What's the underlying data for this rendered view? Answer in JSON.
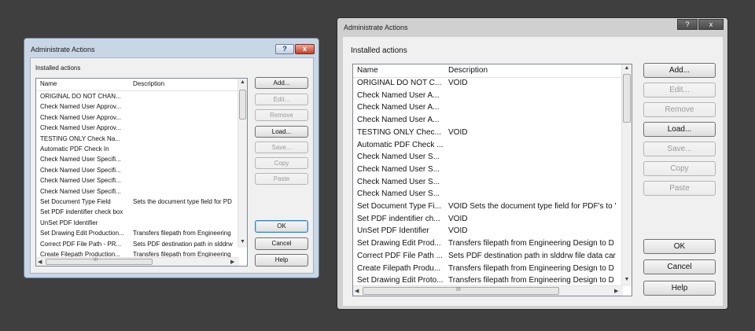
{
  "dialog_title": "Administrate Actions",
  "installed_label": "Installed actions",
  "columns": {
    "name": "Name",
    "description": "Description"
  },
  "title_buttons": {
    "help": "?",
    "close": "x"
  },
  "scroll_grip": "III",
  "buttons": {
    "add": "Add...",
    "edit": "Edit...",
    "remove": "Remove",
    "load": "Load...",
    "save": "Save...",
    "copy": "Copy",
    "paste": "Paste",
    "ok": "OK",
    "cancel": "Cancel",
    "help": "Help"
  },
  "small_rows": [
    {
      "name": "ORIGINAL DO NOT CHAN...",
      "desc": ""
    },
    {
      "name": "Check Named User Approv...",
      "desc": ""
    },
    {
      "name": "Check Named User Approv...",
      "desc": ""
    },
    {
      "name": "Check Named User Approv...",
      "desc": ""
    },
    {
      "name": "TESTING ONLY Check Na...",
      "desc": ""
    },
    {
      "name": "Automatic PDF Check In",
      "desc": ""
    },
    {
      "name": "Check Named User Specifi...",
      "desc": ""
    },
    {
      "name": "Check Named User Specifi...",
      "desc": ""
    },
    {
      "name": "Check Named User Specifi...",
      "desc": ""
    },
    {
      "name": "Check Named User Specifi...",
      "desc": ""
    },
    {
      "name": "Set Document Type Field",
      "desc": "Sets the document type field for PD"
    },
    {
      "name": "Set PDF indentifier check box",
      "desc": ""
    },
    {
      "name": "UnSet PDF Identifier",
      "desc": ""
    },
    {
      "name": "Set Drawing Edit Production...",
      "desc": "Transfers filepath from Engineering"
    },
    {
      "name": "Correct PDF File Path - PR...",
      "desc": "Sets PDF destination path in slddrw"
    },
    {
      "name": "Create Filepath Production...",
      "desc": "Transfers filepath from Engineering"
    }
  ],
  "large_rows": [
    {
      "name": "ORIGINAL DO NOT C...",
      "desc": "VOID"
    },
    {
      "name": "Check Named User A...",
      "desc": ""
    },
    {
      "name": "Check Named User A...",
      "desc": ""
    },
    {
      "name": "Check Named User A...",
      "desc": ""
    },
    {
      "name": "TESTING ONLY Chec...",
      "desc": "VOID"
    },
    {
      "name": "Automatic PDF Check ...",
      "desc": ""
    },
    {
      "name": "Check Named User S...",
      "desc": ""
    },
    {
      "name": "Check Named User S...",
      "desc": ""
    },
    {
      "name": "Check Named User S...",
      "desc": ""
    },
    {
      "name": "Check Named User S...",
      "desc": ""
    },
    {
      "name": "Set Document Type Fi...",
      "desc": "VOID Sets the document type field for PDF's to '"
    },
    {
      "name": "Set PDF indentifier ch...",
      "desc": "VOID"
    },
    {
      "name": "UnSet PDF Identifier",
      "desc": "VOID"
    },
    {
      "name": "Set Drawing Edit Prod...",
      "desc": "Transfers filepath from Engineering Design to D"
    },
    {
      "name": "Correct PDF File Path ...",
      "desc": "Sets PDF destination path in slddrw file data car"
    },
    {
      "name": "Create Filepath Produ...",
      "desc": "Transfers filepath from Engineering Design to D"
    },
    {
      "name": "Set Drawing Edit Proto...",
      "desc": "Transfers filepath from Engineering Design to D"
    }
  ]
}
